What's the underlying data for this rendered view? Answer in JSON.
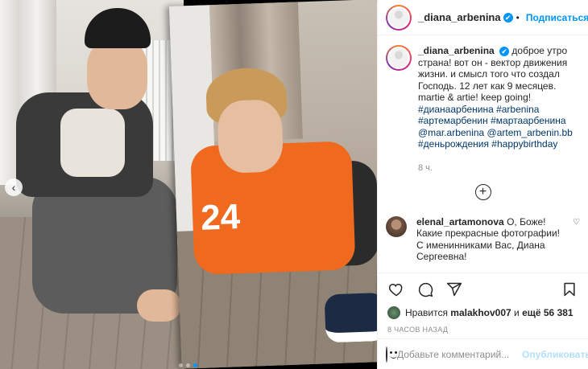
{
  "header": {
    "username": "_diana_arbenina",
    "separator": "•",
    "follow_label": "Подписаться",
    "more_label": "···"
  },
  "caption": {
    "username": "_diana_arbenina",
    "text": "доброе утро страна! вот он - вектор движения жизни. и смысл того что создал Господь. 12 лет как 9 месяцев. martie & artie! keep going!",
    "tags": "#дианаарбенина #arbenina #артемарбенин #мартаарбенина @mar.arbenina @artem_arbenin.bb #деньрождения #happybirthday",
    "time_ago": "8 ч."
  },
  "load_more_label": "+",
  "comment": {
    "username": "elenal_artamonova",
    "text": "О, Боже! Какие прекрасные фотографии! С именинниками Вас, Диана Сергеевна!"
  },
  "likes": {
    "prefix": "Нравится",
    "user": "malakhov007",
    "and_label": "и",
    "others": "ещё 56 381"
  },
  "post_date": "8 ЧАСОВ НАЗАД",
  "add_comment": {
    "placeholder": "Добавьте комментарий...",
    "publish_label": "Опубликовать"
  },
  "carousel": {
    "prev_arrow": "‹",
    "slide_count": 3,
    "active_index": 2
  },
  "icons": {
    "verified": "✔",
    "heart": "♡"
  },
  "colors": {
    "accent": "#0095f6",
    "tag": "#00376b",
    "muted": "#8e8e8e",
    "publish_disabled": "#b2dffc"
  }
}
